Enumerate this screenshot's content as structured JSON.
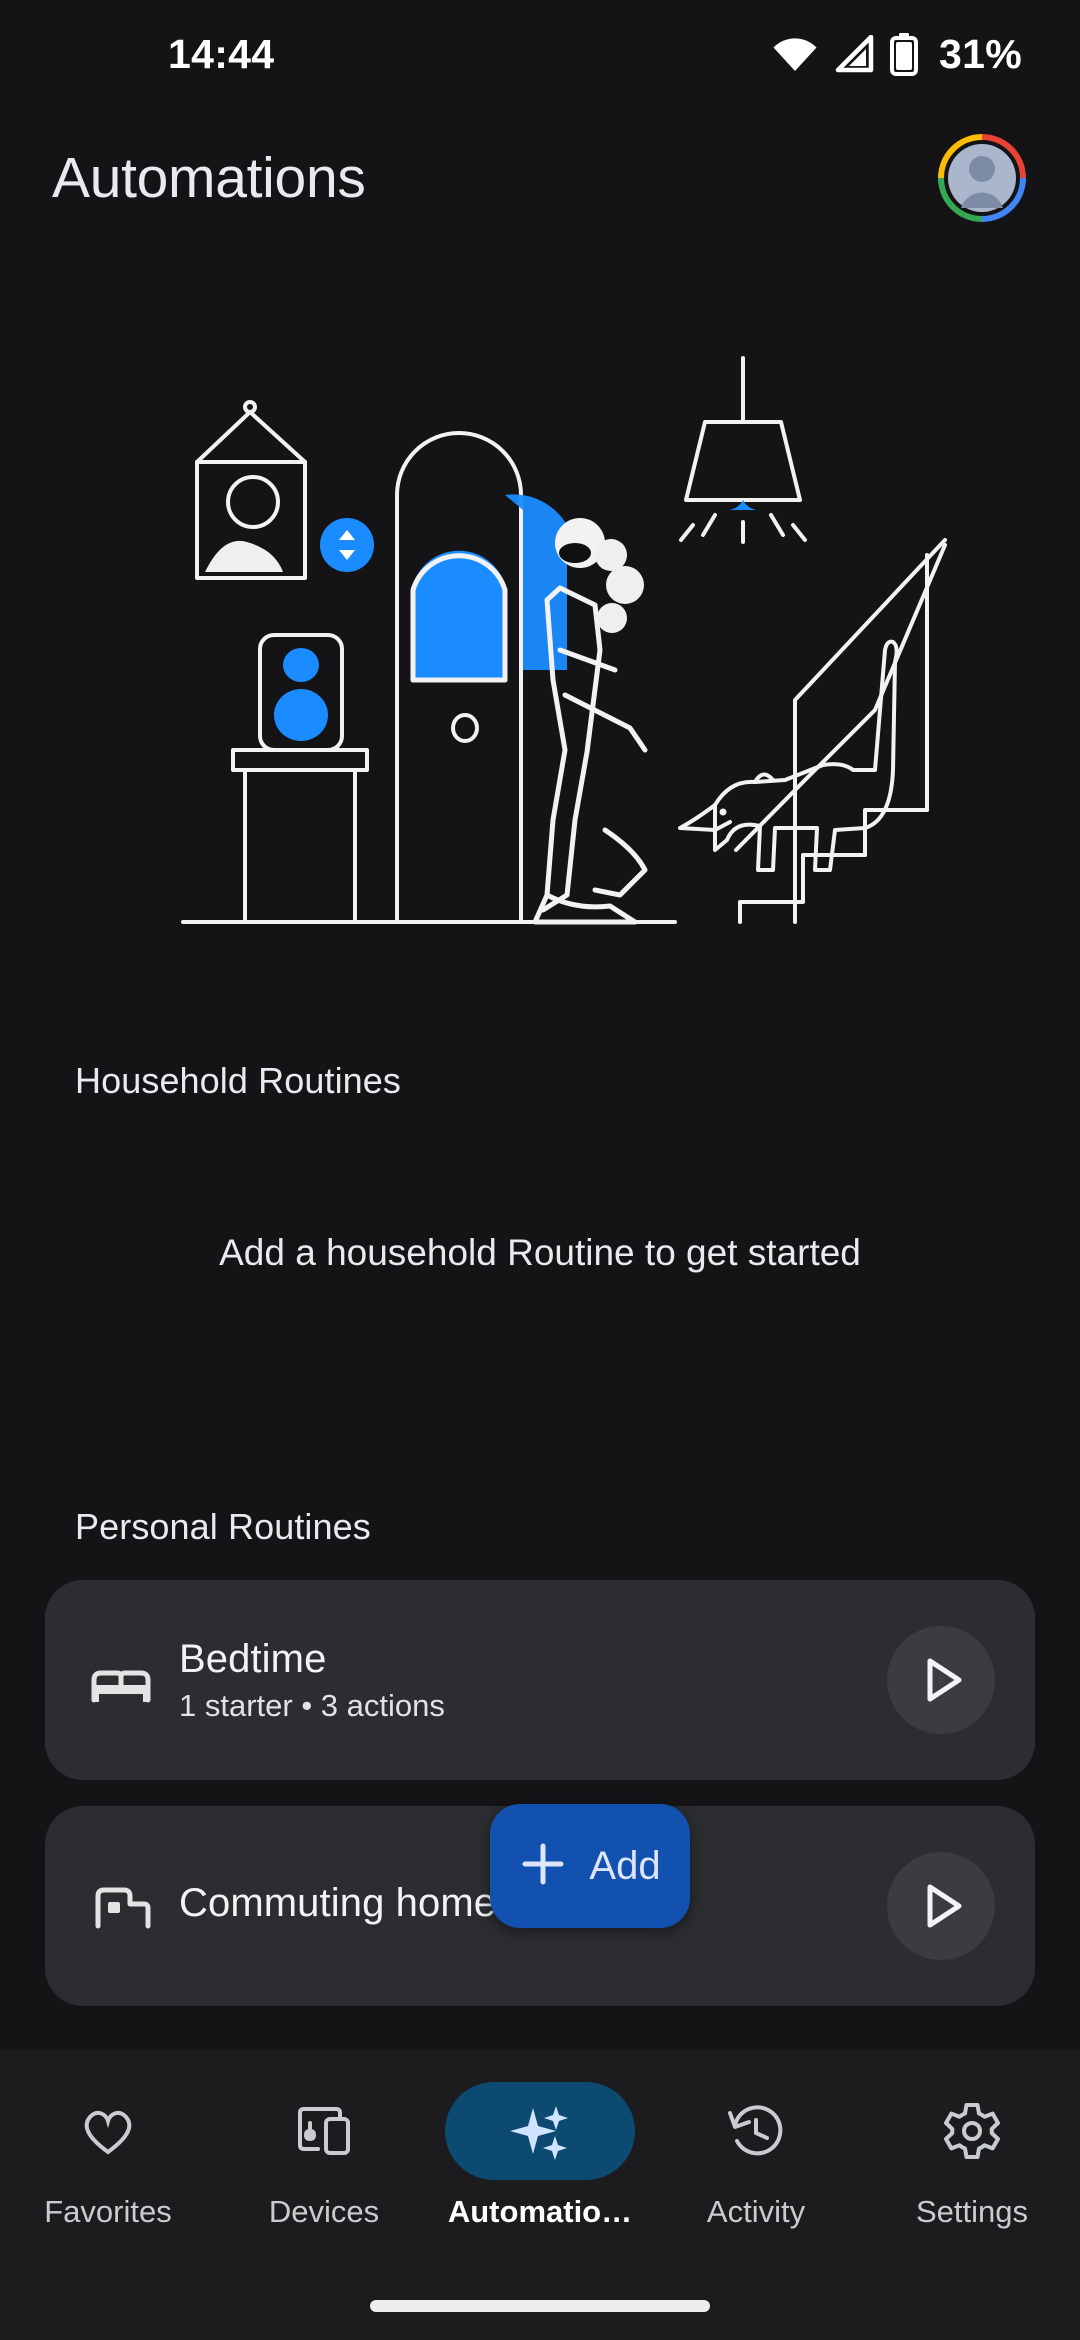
{
  "status_bar": {
    "time": "14:44",
    "battery_percent": "31%",
    "icons": [
      "wifi-icon",
      "cellular-signal-icon",
      "battery-icon"
    ]
  },
  "header": {
    "title": "Automations",
    "avatar_name": "account-avatar",
    "avatar_ring_colors": [
      "#ea4335",
      "#4285f4",
      "#34a853",
      "#fbbc04"
    ]
  },
  "illustration": {
    "name": "home-automation-illustration",
    "accent_color": "#1a8cff",
    "line_color": "#f2f2f2",
    "elements": [
      "picture-frame",
      "thermostat-dial",
      "smart-speaker",
      "pedestal",
      "arched-door",
      "person",
      "pendant-lamp",
      "dog",
      "staircase"
    ]
  },
  "household": {
    "heading": "Household Routines",
    "empty_message": "Add a household Routine to get started"
  },
  "personal": {
    "heading": "Personal Routines",
    "routines": [
      {
        "icon": "bed-icon",
        "title": "Bedtime",
        "subtitle": "1 starter • 3 actions",
        "play_label": "play-icon"
      },
      {
        "icon": "commute-icon",
        "title": "Commuting home",
        "subtitle": "",
        "play_label": "play-icon"
      }
    ]
  },
  "fab": {
    "label": "Add",
    "icon": "plus-icon",
    "color": "#1251b0"
  },
  "bottom_nav": {
    "selected_index": 2,
    "selected_pill_color": "#0d4a72",
    "items": [
      {
        "label": "Favorites",
        "icon": "heart-icon"
      },
      {
        "label": "Devices",
        "icon": "devices-icon"
      },
      {
        "label": "Automatio…",
        "icon": "sparkles-icon"
      },
      {
        "label": "Activity",
        "icon": "history-icon"
      },
      {
        "label": "Settings",
        "icon": "gear-icon"
      }
    ]
  },
  "system": {
    "gesture_bar": "home-gesture-bar"
  }
}
